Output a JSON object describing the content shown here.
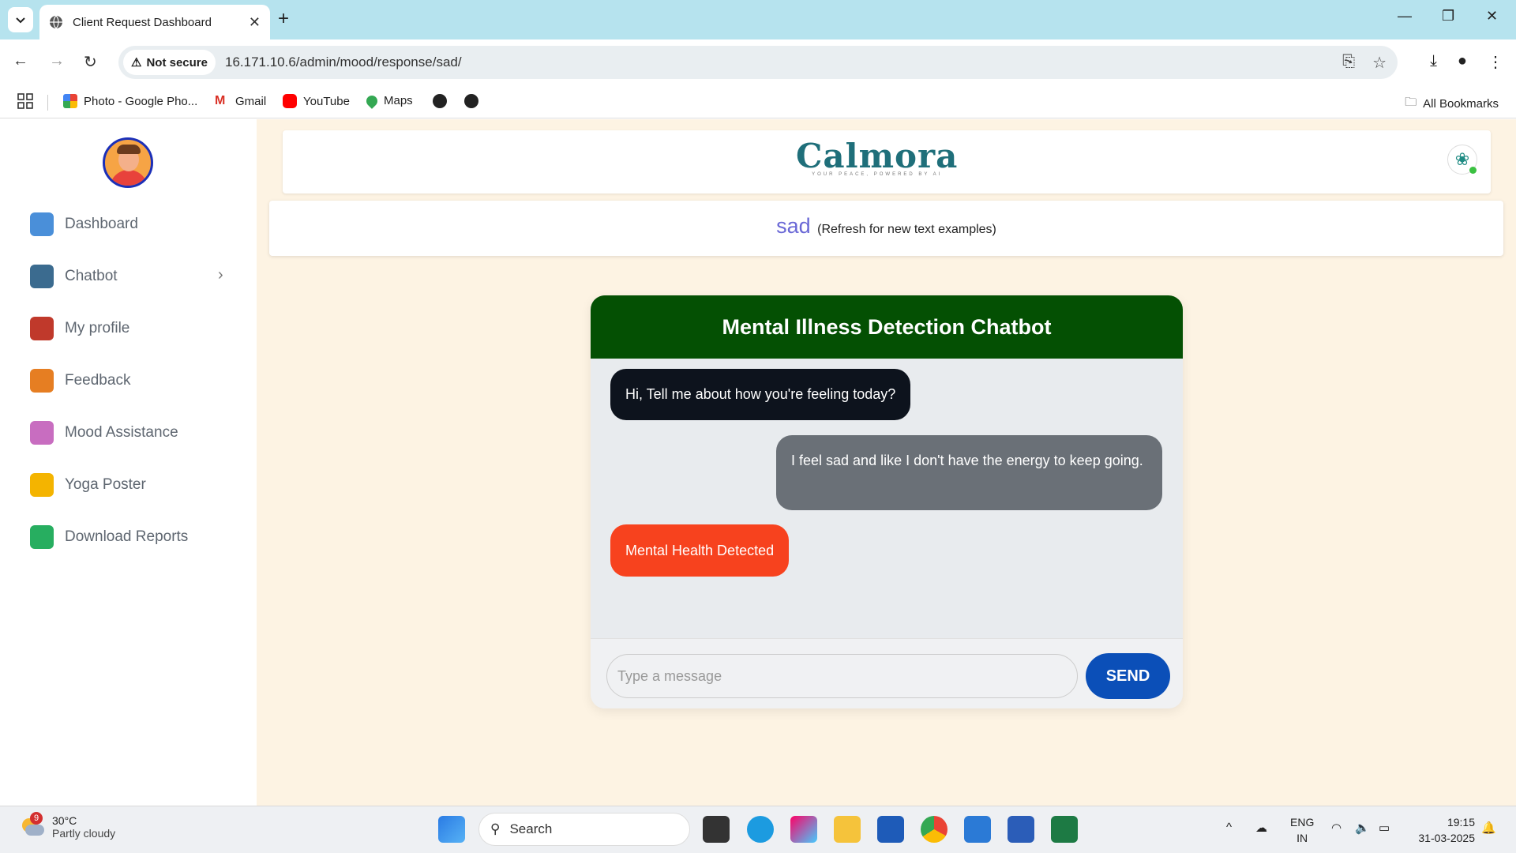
{
  "browser": {
    "tab_title": "Client Request Dashboard",
    "security_label": "Not secure",
    "url": "16.171.10.6/admin/mood/response/sad/",
    "bookmarks": [
      "Photo - Google Pho...",
      "Gmail",
      "YouTube",
      "Maps"
    ],
    "all_bookmarks": "All Bookmarks"
  },
  "sidebar": {
    "items": [
      {
        "label": "Dashboard",
        "icon": "dashboard-icon",
        "color": "#4a8fd9"
      },
      {
        "label": "Chatbot",
        "icon": "chatbot-icon",
        "color": "#3b6b8f"
      },
      {
        "label": "My profile",
        "icon": "profile-icon",
        "color": "#c0392b"
      },
      {
        "label": "Feedback",
        "icon": "feedback-icon",
        "color": "#e67e22"
      },
      {
        "label": "Mood Assistance",
        "icon": "mood-icon",
        "color": "#c86dc0"
      },
      {
        "label": "Yoga Poster",
        "icon": "yoga-icon",
        "color": "#f4b400"
      },
      {
        "label": "Download Reports",
        "icon": "reports-icon",
        "color": "#27ae60"
      }
    ]
  },
  "header": {
    "brand": "Calmora",
    "tagline": "YOUR PEACE, POWERED BY AI"
  },
  "mood": {
    "value": "sad",
    "hint": "(Refresh for new text examples)"
  },
  "chat": {
    "title": "Mental Illness Detection Chatbot",
    "messages": [
      {
        "from": "bot",
        "text": "Hi, Tell me about how you're feeling today?"
      },
      {
        "from": "user",
        "text": "I feel sad and like I don't have the energy to keep going."
      },
      {
        "from": "bot",
        "text": "Mental Health Detected"
      }
    ],
    "input_placeholder": "Type a message",
    "send_label": "SEND"
  },
  "taskbar": {
    "weather_badge": "9",
    "temperature": "30°C",
    "condition": "Partly cloudy",
    "search": "Search",
    "lang1": "ENG",
    "lang2": "IN",
    "time": "19:15",
    "date": "31-03-2025"
  },
  "colors": {
    "chat_header": "#045003",
    "alert": "#f7421e",
    "send": "#0b4fb8",
    "page_bg": "#fdf3e3"
  }
}
